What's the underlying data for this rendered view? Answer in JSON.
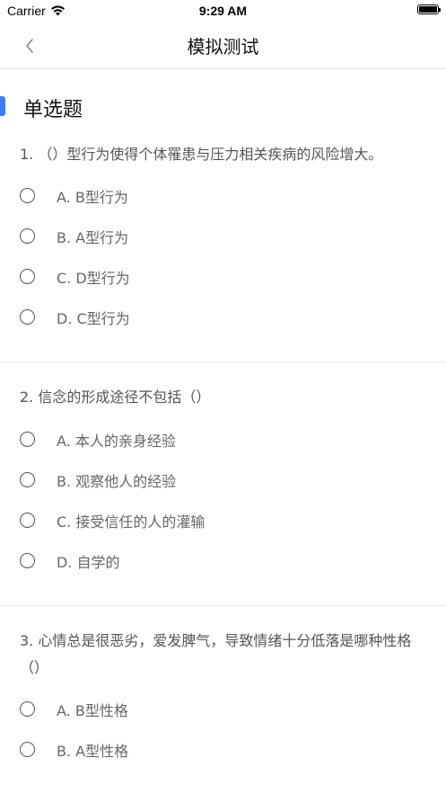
{
  "status_bar": {
    "carrier": "Carrier",
    "time": "9:29 AM"
  },
  "nav": {
    "title": "模拟测试"
  },
  "section": {
    "title": "单选题",
    "accent_color": "#3f7ef3"
  },
  "questions": [
    {
      "text": "1. （）型行为使得个体罹患与压力相关疾病的风险增大。",
      "options": [
        "A. B型行为",
        "B. A型行为",
        "C. D型行为",
        "D. C型行为"
      ]
    },
    {
      "text": "2. 信念的形成途径不包括（）",
      "options": [
        "A. 本人的亲身经验",
        "B. 观察他人的经验",
        "C. 接受信任的人的灌输",
        "D. 自学的"
      ]
    },
    {
      "text": "3. 心情总是很恶劣，爱发脾气，导致情绪十分低落是哪种性格（）",
      "options": [
        "A. B型性格",
        "B. A型性格"
      ]
    }
  ]
}
